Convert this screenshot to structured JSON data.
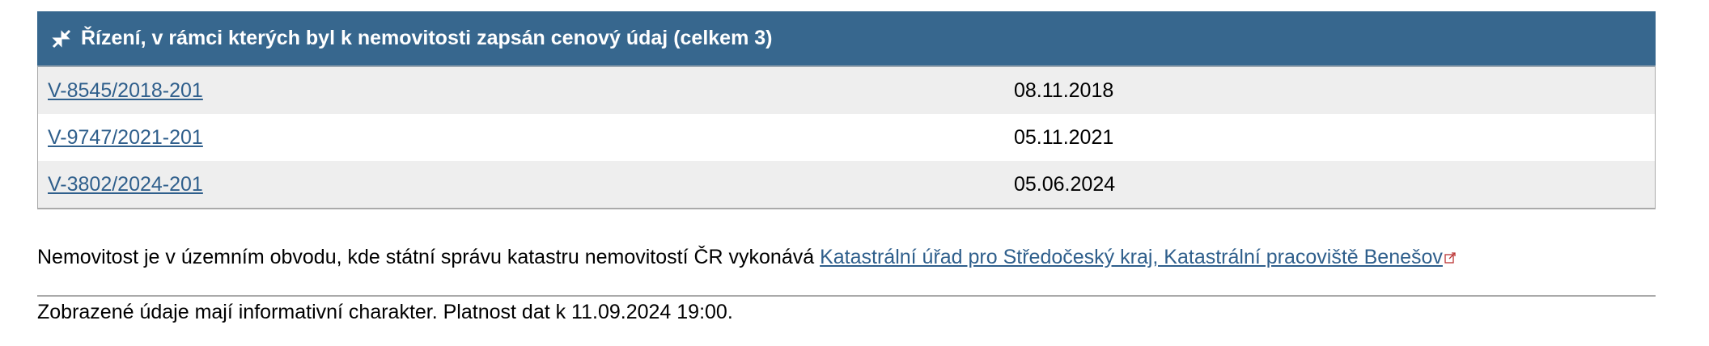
{
  "panel": {
    "title": "Řízení, v rámci kterých byl k nemovitosti zapsán cenový údaj (celkem 3)",
    "icon": "compress-arrows-icon",
    "header_color": "#37678e",
    "rows": [
      {
        "id": "V-8545/2018-201",
        "date": "08.11.2018"
      },
      {
        "id": "V-9747/2021-201",
        "date": "05.11.2021"
      },
      {
        "id": "V-3802/2024-201",
        "date": "05.06.2024"
      }
    ]
  },
  "office": {
    "text": "Nemovitost je v územním obvodu, kde státní správu katastru nemovitostí ČR vykonává ",
    "link": "Katastrální úřad pro Středočeský kraj, Katastrální pracoviště Benešov",
    "icon": "external-link-icon"
  },
  "footer": "Zobrazené údaje mají informativní charakter. Platnost dat k 11.09.2024 19:00."
}
